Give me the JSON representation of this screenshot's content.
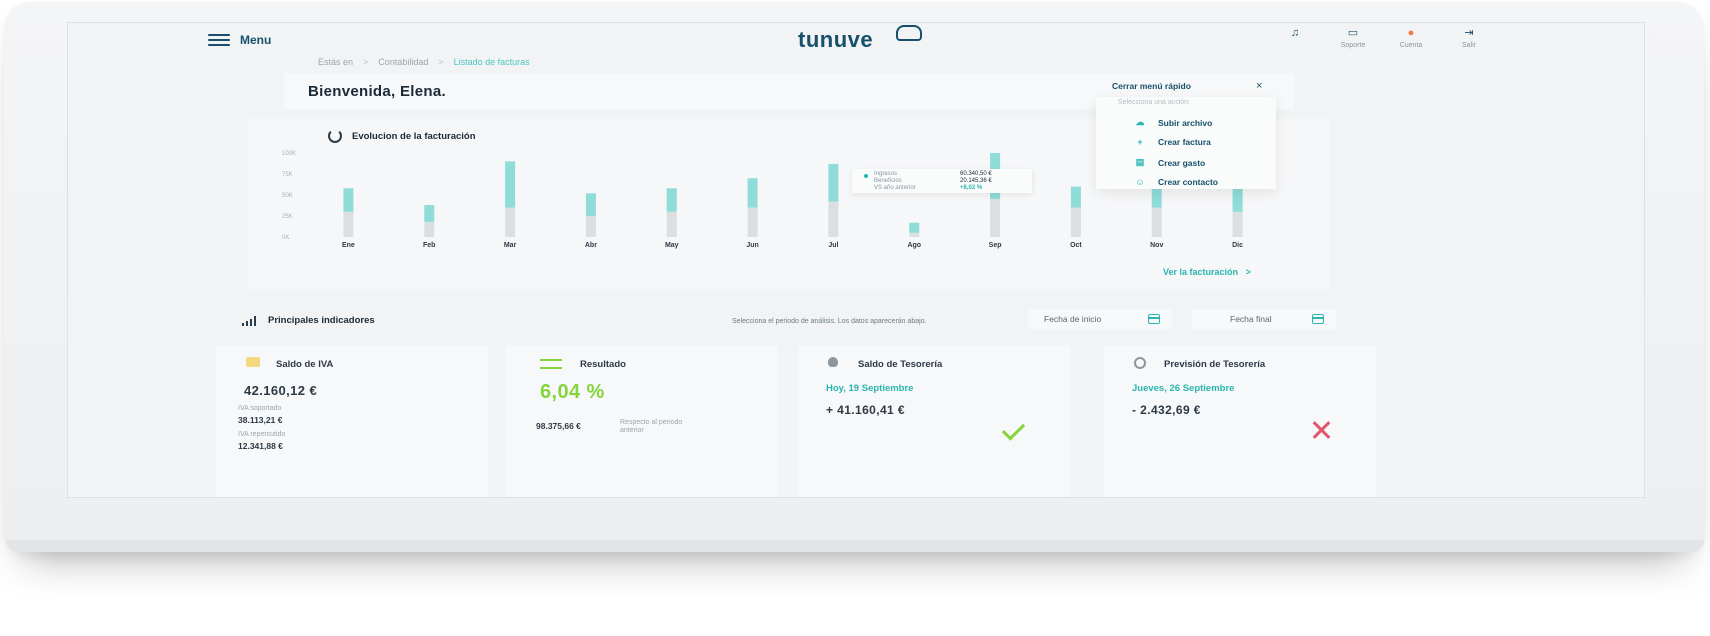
{
  "topbar": {
    "menu_label": "Menu",
    "logo": "tunuve",
    "actions": [
      {
        "label": "",
        "icon": "bell-icon"
      },
      {
        "label": "Soporte",
        "icon": "support-icon"
      },
      {
        "label": "Cuenta",
        "icon": "account-icon"
      },
      {
        "label": "Salir",
        "icon": "logout-icon"
      }
    ]
  },
  "breadcrumb": {
    "prefix": "Estás en",
    "sep": ">",
    "items": [
      "Contabilidad",
      "Listado de facturas"
    ]
  },
  "welcome": "Bienvenida, Elena.",
  "chart": {
    "title": "Evolucion de la facturación",
    "see_more": "Ver la facturación",
    "see_more_arrow": ">",
    "tooltip": {
      "rows": [
        {
          "label": "Ingresos",
          "value": "60.340,50 €"
        },
        {
          "label": "Beneficios",
          "value": "20.145,36 €"
        },
        {
          "label": "VS año anterior",
          "value": "+8,02 %"
        }
      ]
    }
  },
  "chart_data": {
    "type": "bar",
    "title": "Evolucion de la facturación",
    "categories": [
      "Ene",
      "Feb",
      "Mar",
      "Abr",
      "May",
      "Jun",
      "Jul",
      "Ago",
      "Sep",
      "Oct",
      "Nov",
      "Dic"
    ],
    "y_ticks": [
      "100K",
      "75K",
      "50K",
      "25K",
      "0K"
    ],
    "ylim": [
      0,
      100
    ],
    "series": [
      {
        "values": [
          30,
          18,
          35,
          25,
          30,
          35,
          42,
          5,
          45,
          35,
          35,
          30
        ]
      },
      {
        "values": [
          28,
          20,
          55,
          27,
          28,
          35,
          45,
          12,
          55,
          25,
          25,
          30
        ]
      }
    ],
    "colors": [
      "#dcdfe1",
      "#8fdcd8"
    ],
    "grid": false
  },
  "quick_menu": {
    "close_label": "Cerrar menú rápido",
    "close_icon": "×",
    "hint": "Selecciona una acción:",
    "items": [
      {
        "label": "Subir archivo",
        "icon": "upload-cloud-icon",
        "glyph": "☁"
      },
      {
        "label": "Crear factura",
        "icon": "plus-icon",
        "glyph": "+"
      },
      {
        "label": "Crear gasto",
        "icon": "receipt-icon",
        "glyph": "▤"
      },
      {
        "label": "Crear contacto",
        "icon": "contact-icon",
        "glyph": "☺"
      }
    ]
  },
  "indicators": {
    "title": "Principales indicadores",
    "hint": "Selecciona el periodo de análisis. Los datos aparecerán abajo.",
    "start_date": "Fecha de inicio",
    "end_date": "Fecha final"
  },
  "kpis": {
    "iva": {
      "title": "Saldo de IVA",
      "value": "42.160,12 €",
      "soportado_label": "IVA soportado",
      "soportado_value": "38.113,21 €",
      "repercutido_label": "IVA repercutido",
      "repercutido_value": "12.341,88 €"
    },
    "resultado": {
      "title": "Resultado",
      "value": "6,04 %",
      "amount": "98.375,66 €",
      "note": "Respecto al periodo anterior"
    },
    "tesoreria": {
      "title": "Saldo de Tesorería",
      "date": "Hoy, 19 Septiembre",
      "value": "+ 41.160,41 €",
      "status": "ok"
    },
    "prevision": {
      "title": "Previsión de Tesorería",
      "date": "Jueves, 26 Septiembre",
      "value": "- 2.432,69 €",
      "status": "alert"
    }
  },
  "colors": {
    "brand": "#16506a",
    "accent": "#2ab6b0",
    "positive": "#86d43c",
    "negative": "#e0566a"
  }
}
